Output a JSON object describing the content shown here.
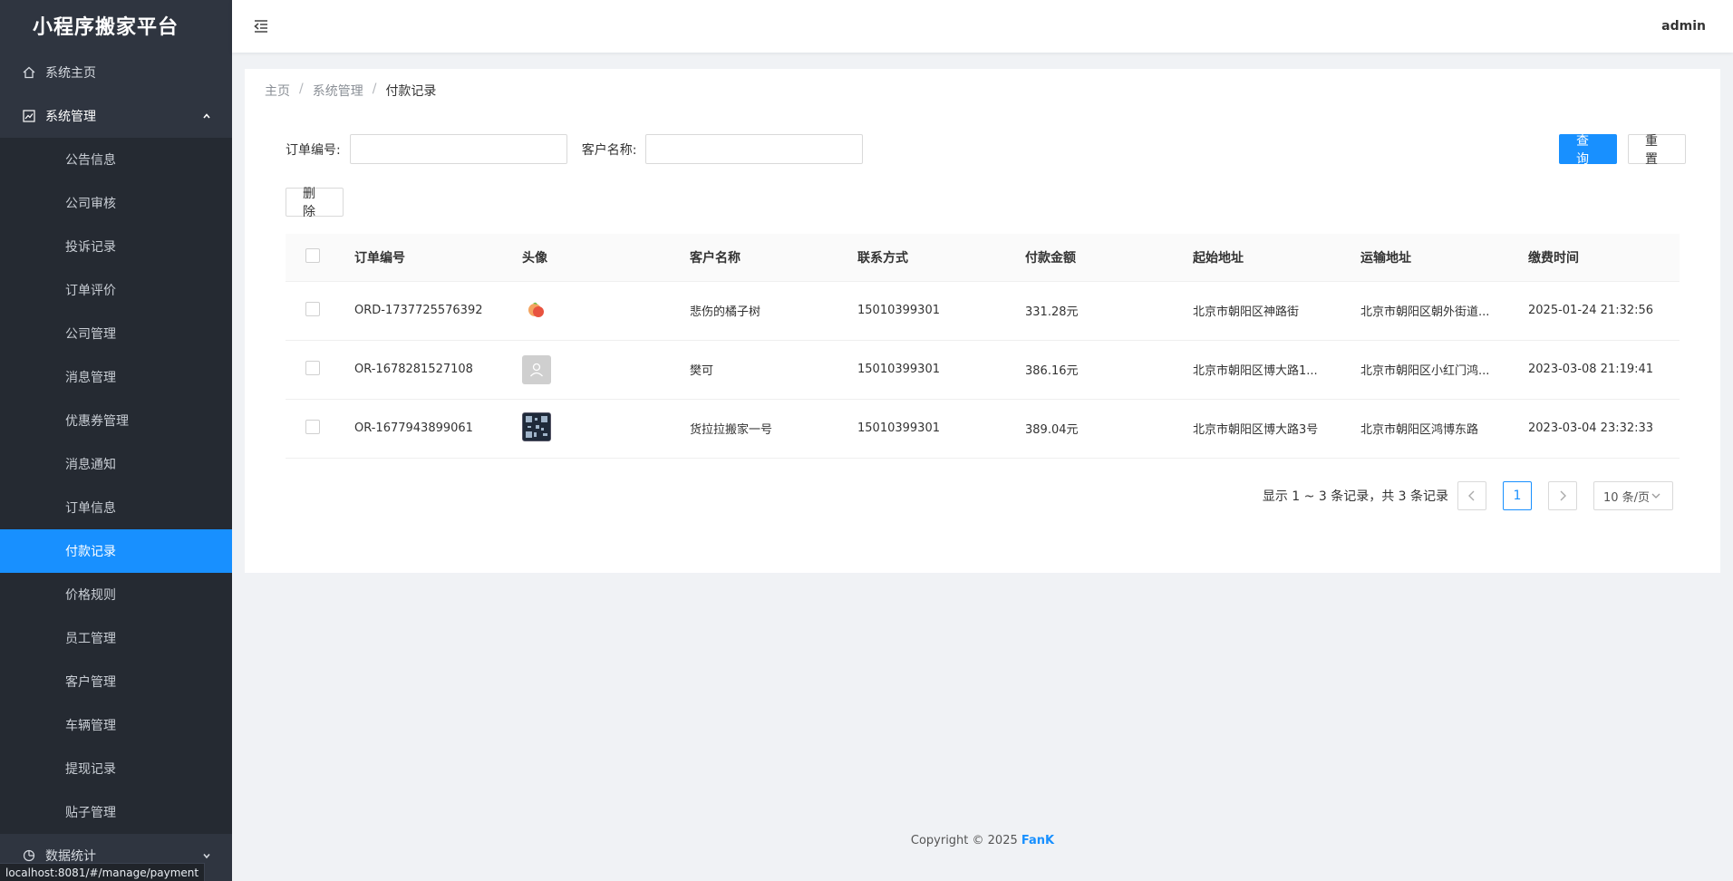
{
  "sidebar": {
    "logo": "小程序搬家平台",
    "home": "系统主页",
    "system_group": "系统管理",
    "items": [
      {
        "label": "公告信息"
      },
      {
        "label": "公司审核"
      },
      {
        "label": "投诉记录"
      },
      {
        "label": "订单评价"
      },
      {
        "label": "公司管理"
      },
      {
        "label": "消息管理"
      },
      {
        "label": "优惠券管理"
      },
      {
        "label": "消息通知"
      },
      {
        "label": "订单信息"
      },
      {
        "label": "付款记录"
      },
      {
        "label": "价格规则"
      },
      {
        "label": "员工管理"
      },
      {
        "label": "客户管理"
      },
      {
        "label": "车辆管理"
      },
      {
        "label": "提现记录"
      },
      {
        "label": "贴子管理"
      }
    ],
    "stats_group": "数据统计",
    "active_item": "付款记录"
  },
  "status_url": "localhost:8081/#/manage/payment",
  "header": {
    "user": "admin"
  },
  "breadcrumb": [
    "主页",
    "系统管理",
    "付款记录"
  ],
  "filter": {
    "order_label": "订单编号:",
    "order_value": "",
    "customer_label": "客户名称:",
    "customer_value": "",
    "query_label": "查 询",
    "reset_label": "重 置",
    "delete_label": "删 除"
  },
  "table": {
    "headers": [
      "订单编号",
      "头像",
      "客户名称",
      "联系方式",
      "付款金额",
      "起始地址",
      "运输地址",
      "缴费时间"
    ],
    "rows": [
      {
        "order": "ORD-1737725576392",
        "avatar": "peach-avatar",
        "name": "悲伤的橘子树",
        "phone": "15010399301",
        "amount": "331.28元",
        "start": "北京市朝阳区神路街",
        "dest": "北京市朝阳区朝外街道...",
        "time": "2025-01-24 21:32:56"
      },
      {
        "order": "OR-1678281527108",
        "avatar": "default-avatar",
        "name": "樊可",
        "phone": "15010399301",
        "amount": "386.16元",
        "start": "北京市朝阳区博大路1...",
        "dest": "北京市朝阳区小红门鸿...",
        "time": "2023-03-08 21:19:41"
      },
      {
        "order": "OR-1677943899061",
        "avatar": "qr-avatar",
        "name": "货拉拉搬家一号",
        "phone": "15010399301",
        "amount": "389.04元",
        "start": "北京市朝阳区博大路3号",
        "dest": "北京市朝阳区鸿博东路",
        "time": "2023-03-04 23:32:33"
      }
    ]
  },
  "pagination": {
    "summary": "显示 1 ~ 3 条记录，共 3 条记录",
    "current": "1",
    "page_size": "10 条/页"
  },
  "footer": {
    "copyright": "Copyright © 2025 ",
    "brand": "FanK"
  },
  "colors": {
    "primary": "#1890ff",
    "sidebar_bg": "#2f3540",
    "submenu_bg": "#252a32"
  }
}
